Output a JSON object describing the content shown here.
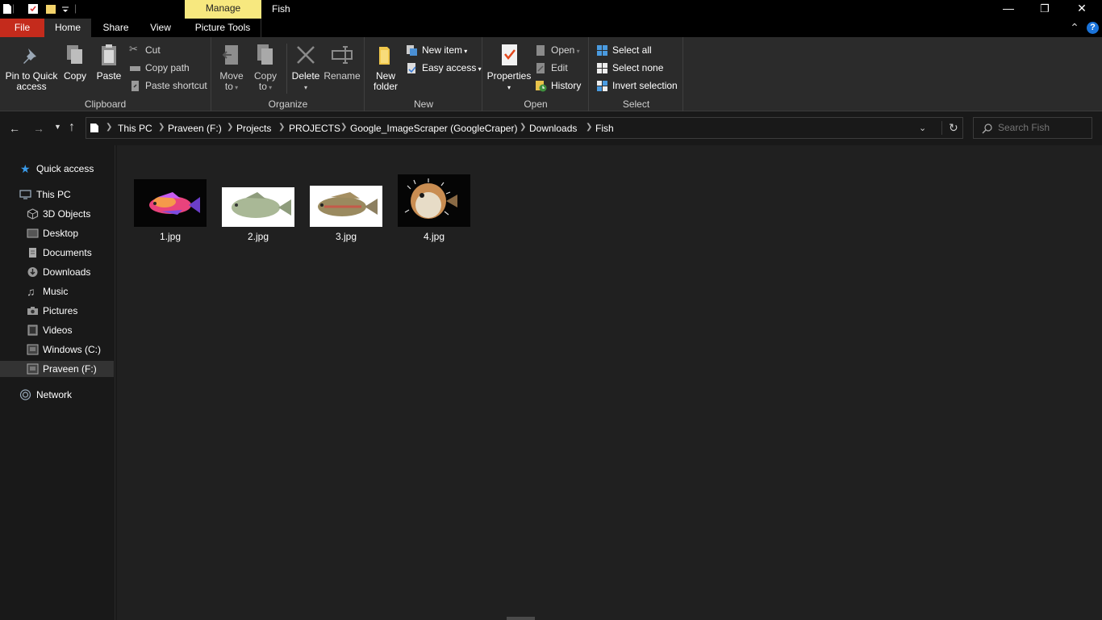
{
  "titlebar": {
    "context_tab": "Manage",
    "window_title": "Fish",
    "minimize": "—",
    "restore": "❐",
    "close": "✕"
  },
  "tabs": {
    "file": "File",
    "home": "Home",
    "share": "Share",
    "view": "View",
    "picture_tools": "Picture Tools",
    "collapse": "⌃",
    "help": "?"
  },
  "ribbon": {
    "clipboard": {
      "label": "Clipboard",
      "pin_line1": "Pin to Quick",
      "pin_line2": "access",
      "copy": "Copy",
      "paste": "Paste",
      "cut": "Cut",
      "copy_path": "Copy path",
      "paste_shortcut": "Paste shortcut"
    },
    "organize": {
      "label": "Organize",
      "move_line1": "Move",
      "move_line2": "to",
      "copy_line1": "Copy",
      "copy_line2": "to",
      "delete": "Delete",
      "rename": "Rename"
    },
    "new": {
      "label": "New",
      "new_folder_line1": "New",
      "new_folder_line2": "folder",
      "new_item": "New item",
      "easy_access": "Easy access"
    },
    "open": {
      "label": "Open",
      "properties": "Properties",
      "open": "Open",
      "edit": "Edit",
      "history": "History"
    },
    "select": {
      "label": "Select",
      "select_all": "Select all",
      "select_none": "Select none",
      "invert_selection": "Invert selection"
    }
  },
  "address": {
    "crumbs": [
      "This PC",
      "Praveen (F:)",
      "Projects",
      "PROJECTS",
      "Google_ImageScraper (GoogleCraper)",
      "Downloads",
      "Fish"
    ],
    "search_placeholder": "Search Fish"
  },
  "nav": {
    "quick_access": "Quick access",
    "this_pc": "This PC",
    "objects3d": "3D Objects",
    "desktop": "Desktop",
    "documents": "Documents",
    "downloads": "Downloads",
    "music": "Music",
    "pictures": "Pictures",
    "videos": "Videos",
    "windows_c": "Windows (C:)",
    "praveen_f": "Praveen (F:)",
    "network": "Network"
  },
  "files": [
    {
      "name": "1.jpg"
    },
    {
      "name": "2.jpg"
    },
    {
      "name": "3.jpg"
    },
    {
      "name": "4.jpg"
    }
  ]
}
